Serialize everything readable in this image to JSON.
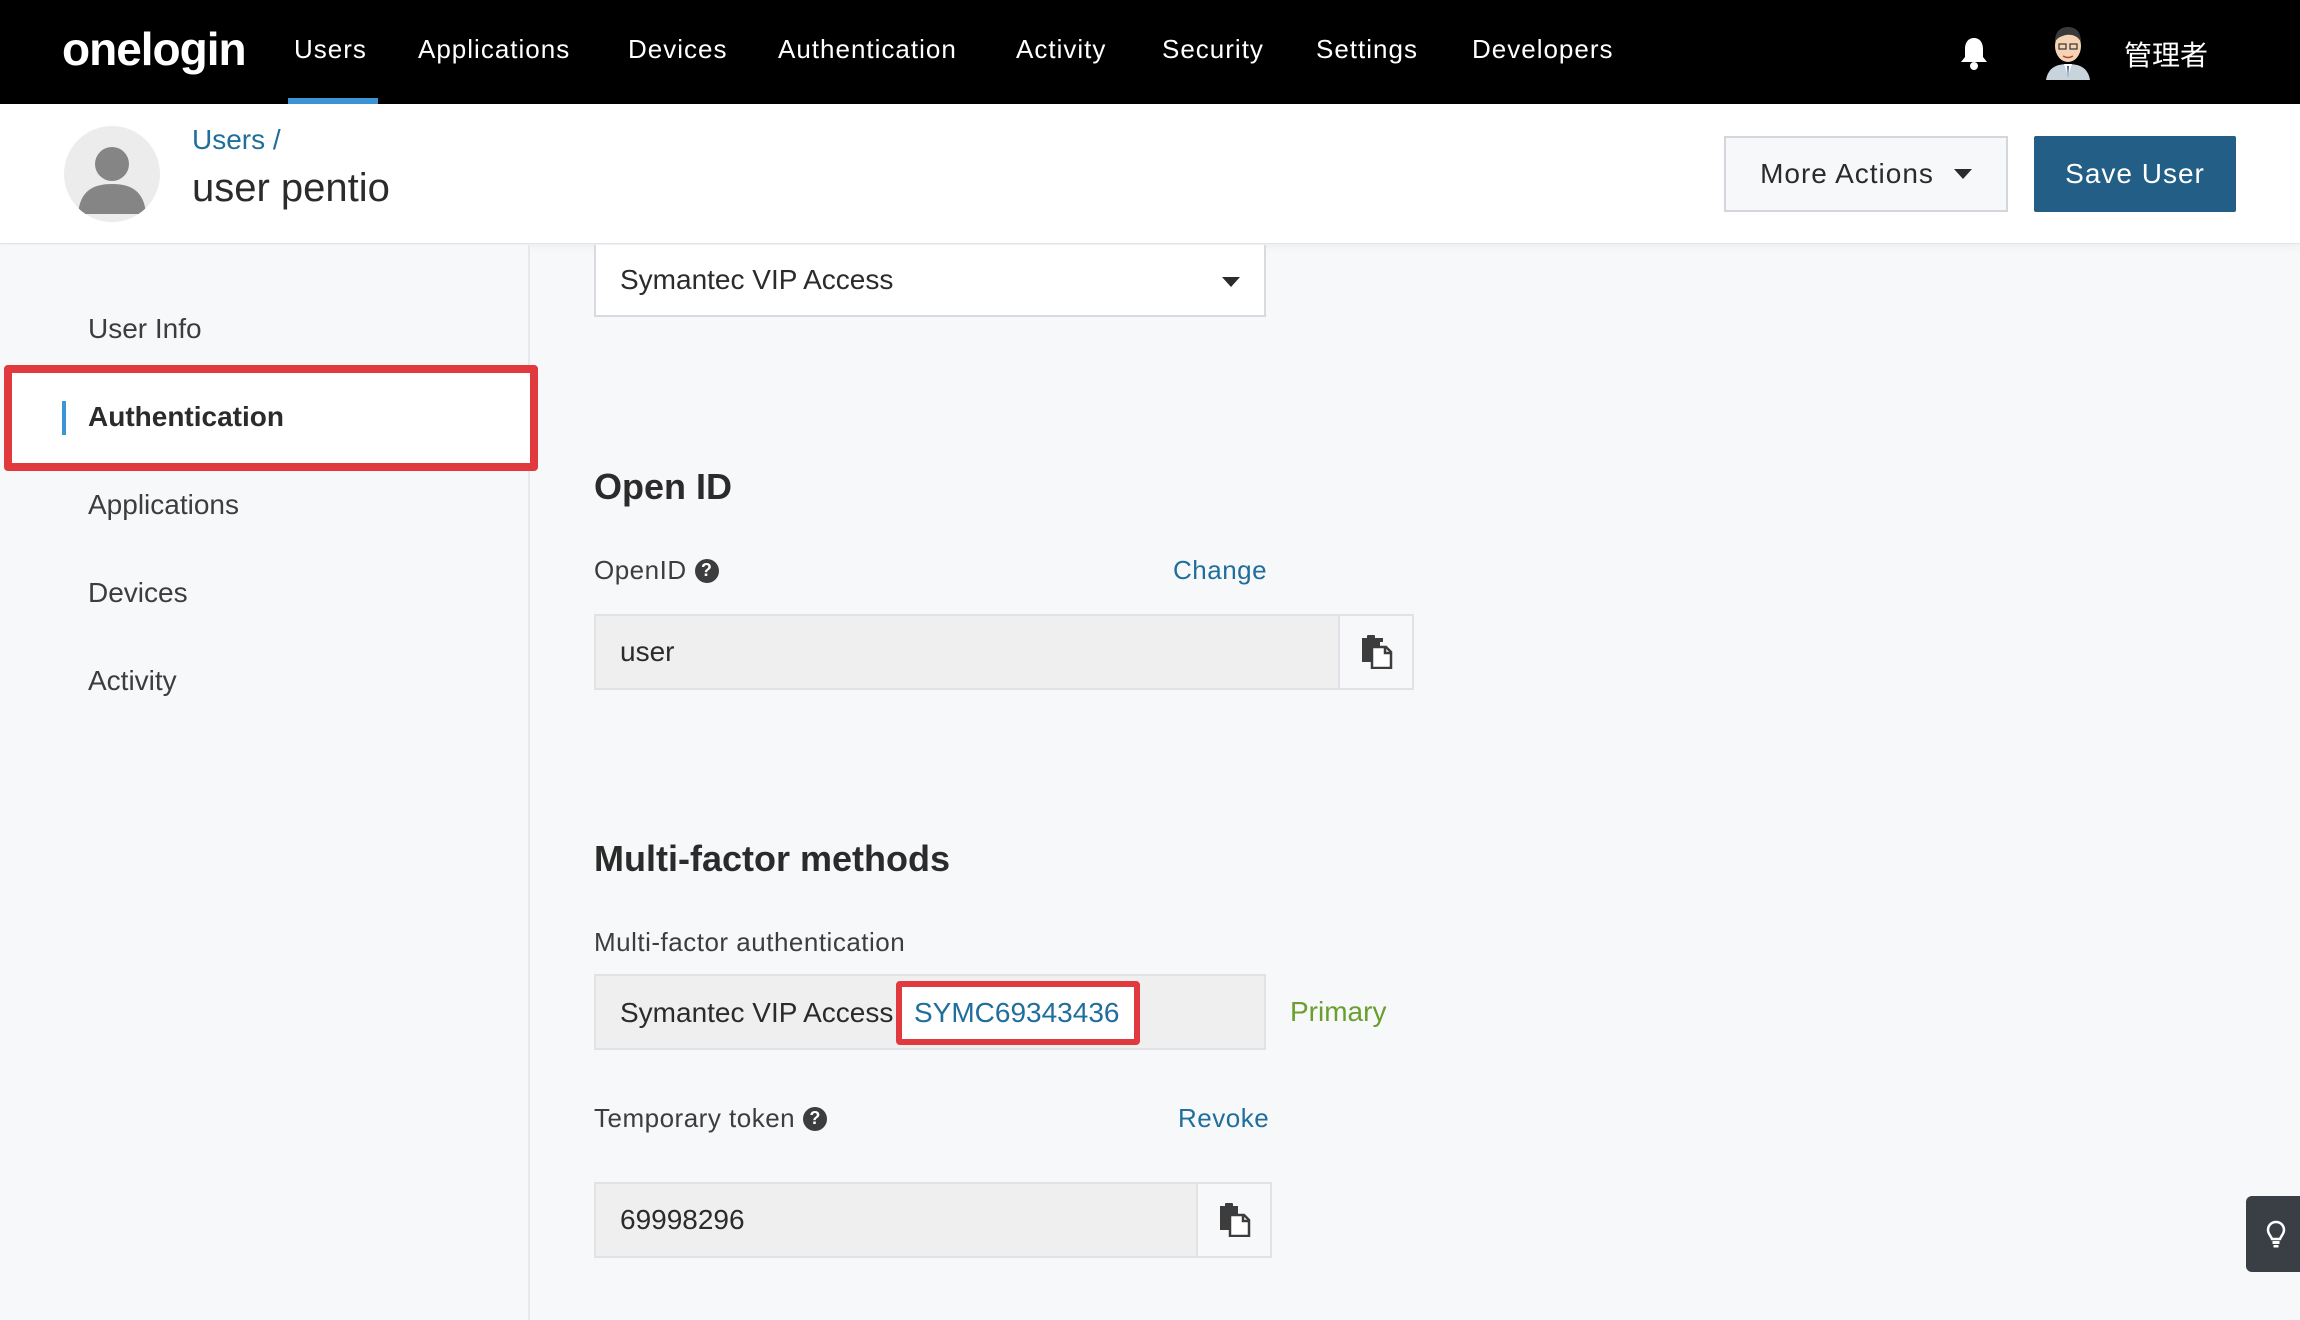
{
  "app": {
    "logo": "onelogin"
  },
  "nav": {
    "items": [
      "Users",
      "Applications",
      "Devices",
      "Authentication",
      "Activity",
      "Security",
      "Settings",
      "Developers"
    ],
    "active": "Users",
    "admin_name": "管理者"
  },
  "header": {
    "breadcrumb": "Users /",
    "title": "user pentio",
    "more_actions": "More Actions",
    "save_user": "Save User"
  },
  "sidebar": {
    "items": [
      {
        "label": "User Info"
      },
      {
        "label": "Authentication"
      },
      {
        "label": "Applications"
      },
      {
        "label": "Devices"
      },
      {
        "label": "Activity"
      }
    ],
    "active": "Authentication"
  },
  "main": {
    "policy_select_value": "Symantec VIP Access",
    "openid_section": {
      "title": "Open ID",
      "field_label": "OpenID",
      "change_link": "Change",
      "value": "user"
    },
    "mfa_section": {
      "title": "Multi-factor methods",
      "field_label": "Multi-factor authentication",
      "method_name": "Symantec VIP Access",
      "serial": "SYMC69343436",
      "status": "Primary",
      "temp_token_label": "Temporary token",
      "revoke_link": "Revoke",
      "temp_token_value": "69998296"
    }
  },
  "colors": {
    "nav_bg": "#000000",
    "accent": "#3d95d3",
    "primary_button": "#225e85",
    "link": "#1f6e9b",
    "highlight": "#e0393e",
    "primary_status": "#6a9e2e"
  }
}
